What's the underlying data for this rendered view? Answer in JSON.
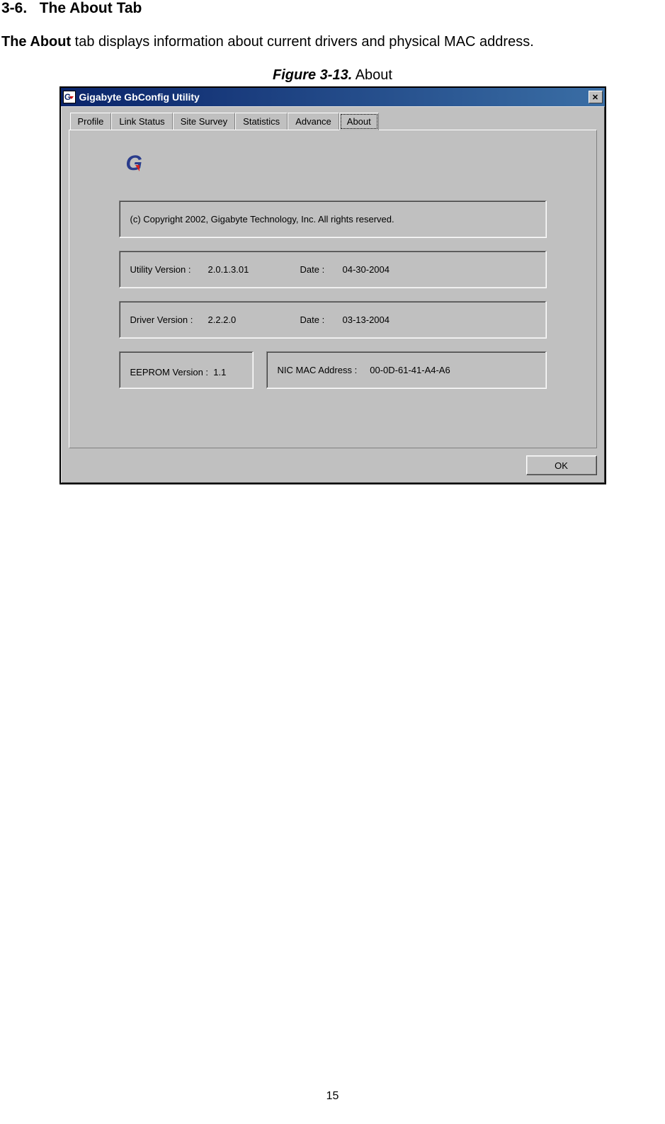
{
  "doc": {
    "section_number": "3-6.",
    "section_title": "The About Tab",
    "intro_bold": "The About",
    "intro_rest": " tab displays information about current drivers and physical MAC address.",
    "figure_label": "Figure 3-13.",
    "figure_title": "   About",
    "page_number": "15"
  },
  "window": {
    "title": "Gigabyte GbConfig Utility",
    "close_symbol": "✕",
    "tabs": {
      "profile": "Profile",
      "link_status": "Link Status",
      "site_survey": "Site Survey",
      "statistics": "Statistics",
      "advance": "Advance",
      "about": "About"
    },
    "about": {
      "copyright": "(c) Copyright 2002, Gigabyte Technology, Inc.  All rights reserved.",
      "utility_version_label": "Utility Version :",
      "utility_version_value": "2.0.1.3.01",
      "utility_date_label": "Date :",
      "utility_date_value": "04-30-2004",
      "driver_version_label": "Driver Version :",
      "driver_version_value": "2.2.2.0",
      "driver_date_label": "Date :",
      "driver_date_value": "03-13-2004",
      "eeprom_label": "EEPROM Version :",
      "eeprom_value": "1.1",
      "mac_label": "NIC MAC Address :",
      "mac_value": "00-0D-61-41-A4-A6",
      "ok_button": "OK"
    }
  }
}
